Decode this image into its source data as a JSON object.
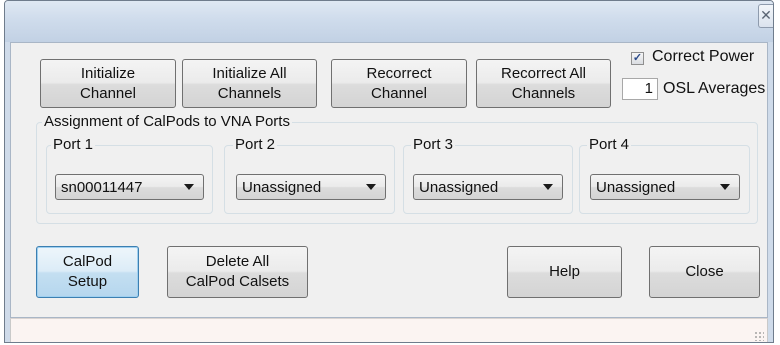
{
  "window": {
    "close_glyph": "✕"
  },
  "toolbar": {
    "initialize_channel": "Initialize\nChannel",
    "initialize_all_channels": "Initialize All\nChannels",
    "recorrect_channel": "Recorrect\nChannel",
    "recorrect_all_channels": "Recorrect All\nChannels"
  },
  "options": {
    "correct_power_label": "Correct Power",
    "correct_power_checked": true,
    "check_glyph": "✓",
    "osl_averages_value": "1",
    "osl_averages_label": "OSL Averages"
  },
  "assignment": {
    "title": "Assignment of CalPods to VNA Ports",
    "ports": [
      {
        "label": "Port 1",
        "value": "sn00011447"
      },
      {
        "label": "Port 2",
        "value": "Unassigned"
      },
      {
        "label": "Port 3",
        "value": "Unassigned"
      },
      {
        "label": "Port 4",
        "value": "Unassigned"
      }
    ]
  },
  "footer": {
    "calpod_setup": "CalPod\nSetup",
    "delete_all_calsets": "Delete All\nCalPod Calsets",
    "help": "Help",
    "close": "Close"
  },
  "icons": {
    "close": "close-icon",
    "dropdown": "chevron-down-icon",
    "resize": "resize-grip-icon"
  }
}
